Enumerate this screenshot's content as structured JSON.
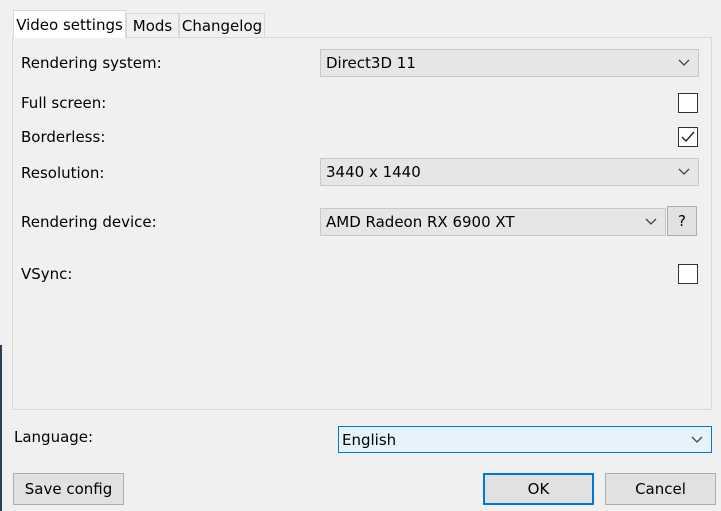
{
  "tabs": [
    {
      "label": "Video settings",
      "active": true
    },
    {
      "label": "Mods",
      "active": false
    },
    {
      "label": "Changelog",
      "active": false
    }
  ],
  "video_settings": {
    "rendering_system": {
      "label": "Rendering system:",
      "value": "Direct3D 11"
    },
    "full_screen": {
      "label": "Full screen:",
      "checked": false
    },
    "borderless": {
      "label": "Borderless:",
      "checked": true
    },
    "resolution": {
      "label": "Resolution:",
      "value": "3440 x 1440"
    },
    "rendering_device": {
      "label": "Rendering device:",
      "value": "AMD Radeon RX 6900 XT",
      "help_label": "?"
    },
    "vsync": {
      "label": "VSync:",
      "checked": false
    }
  },
  "language": {
    "label": "Language:",
    "value": "English"
  },
  "buttons": {
    "save_config": "Save config",
    "ok": "OK",
    "cancel": "Cancel"
  },
  "colors": {
    "accent": "#0078d7",
    "window_bg": "#f0f0f0"
  }
}
